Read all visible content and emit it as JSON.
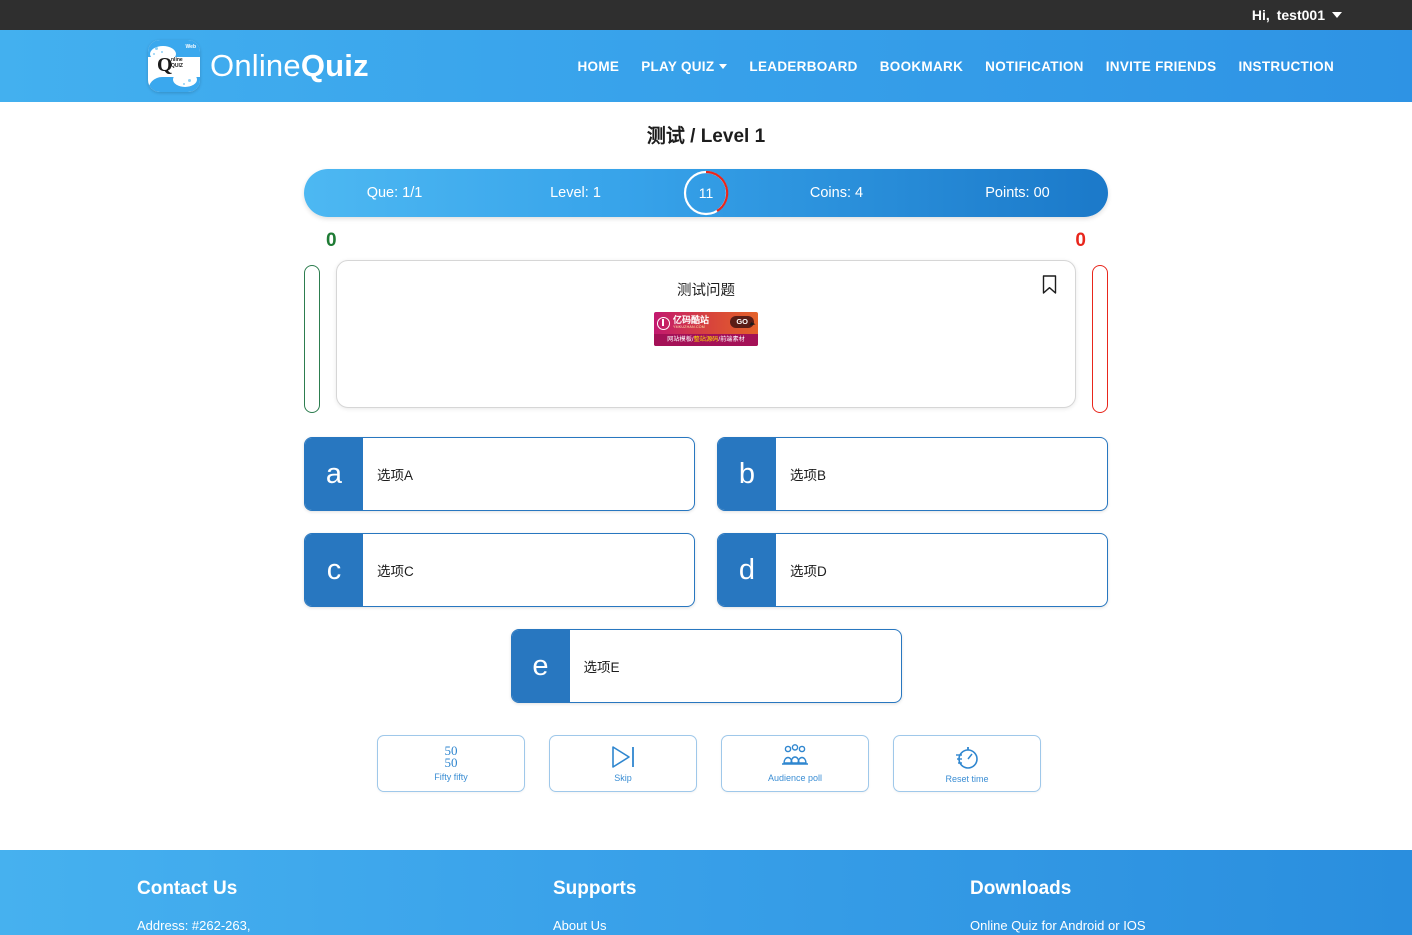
{
  "topbar": {
    "greeting": "Hi,",
    "username": "test001",
    "caret_icon": "chevron-down-icon"
  },
  "brand": {
    "name_light": "Online",
    "name_bold": "Quiz",
    "logo_q": "Q",
    "logo_sub_line1": "nline",
    "logo_sub_line2": "QUIZ",
    "logo_badge": "Web"
  },
  "nav": {
    "items": [
      {
        "label": "HOME",
        "has_caret": false
      },
      {
        "label": "PLAY QUIZ",
        "has_caret": true
      },
      {
        "label": "LEADERBOARD",
        "has_caret": false
      },
      {
        "label": "BOOKMARK",
        "has_caret": false
      },
      {
        "label": "NOTIFICATION",
        "has_caret": false
      },
      {
        "label": "INVITE FRIENDS",
        "has_caret": false
      },
      {
        "label": "INSTRUCTION",
        "has_caret": false
      }
    ]
  },
  "page": {
    "category": "测试",
    "separator": "/",
    "level_label": "Level 1"
  },
  "status": {
    "question": "Que: 1/1",
    "level": "Level: 1",
    "timer": "11",
    "coins": "Coins: 4",
    "points": "Points: 00"
  },
  "scores": {
    "correct": "0",
    "wrong": "0"
  },
  "question": {
    "text": "测试问题",
    "bookmark_icon": "bookmark-icon",
    "image": {
      "brand_cn": "亿码酷站",
      "brand_url": "YMKUZHAN.COM",
      "go_label": "GO",
      "tag1": "网站模板/",
      "tag2": "整站源码",
      "tag3": "/前端素材"
    }
  },
  "options": [
    {
      "letter": "a",
      "text": "选项A"
    },
    {
      "letter": "b",
      "text": "选项B"
    },
    {
      "letter": "c",
      "text": "选项C"
    },
    {
      "letter": "d",
      "text": "选项D"
    },
    {
      "letter": "e",
      "text": "选项E"
    }
  ],
  "lifelines": [
    {
      "label": "Fifty fifty",
      "icon": "fifty-fifty-icon",
      "top": "50",
      "bottom": "50"
    },
    {
      "label": "Skip",
      "icon": "skip-icon"
    },
    {
      "label": "Audience poll",
      "icon": "audience-poll-icon"
    },
    {
      "label": "Reset time",
      "icon": "reset-time-icon"
    }
  ],
  "footer": {
    "columns": [
      {
        "title": "Contact Us",
        "item": "Address: #262-263,"
      },
      {
        "title": "Supports",
        "item": "About Us"
      },
      {
        "title": "Downloads",
        "item": "Online Quiz for Android or IOS"
      }
    ]
  },
  "colors": {
    "brand_blue": "#3aa5ec",
    "option_blue": "#2877c0",
    "correct_green": "#1e7b34",
    "wrong_red": "#e8261c",
    "topbar_dark": "#2f2f2f"
  }
}
